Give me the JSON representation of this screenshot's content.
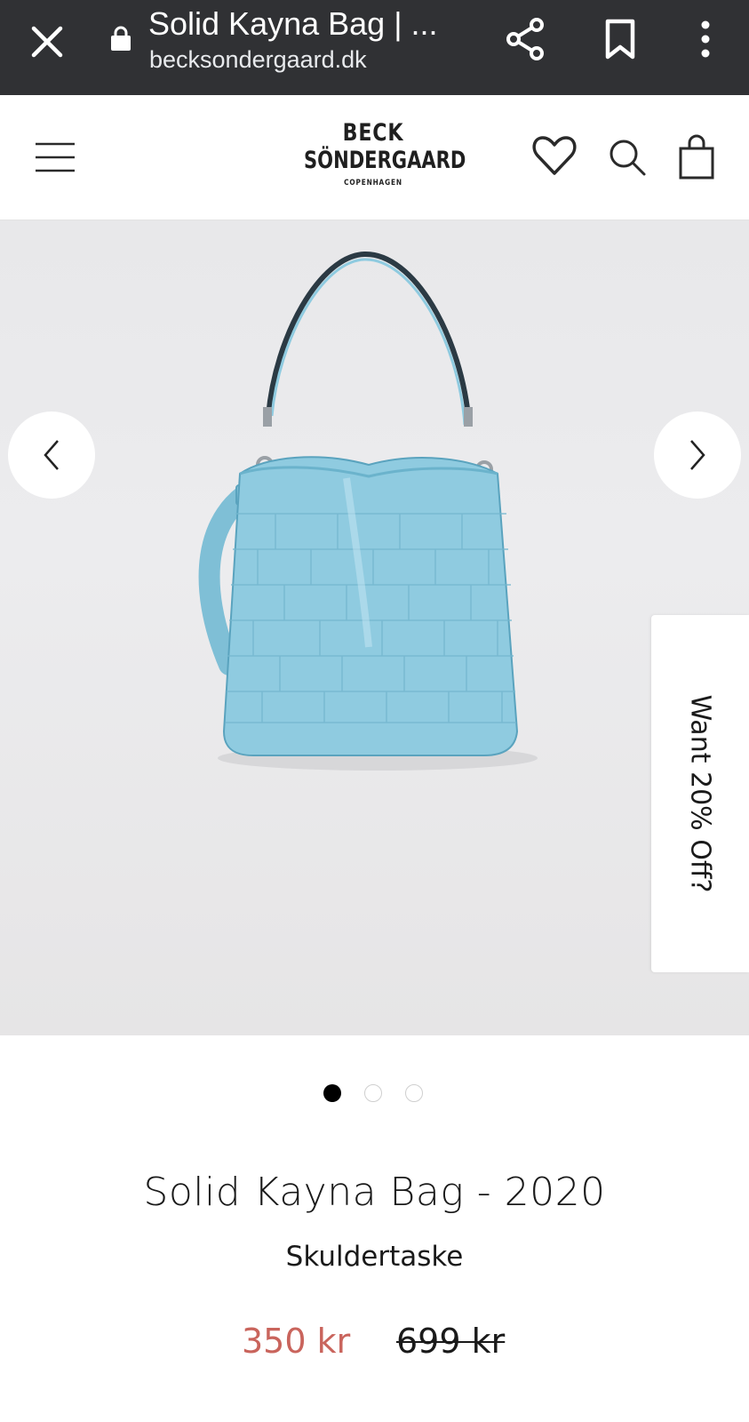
{
  "browser": {
    "tab_title": "Solid Kayna Bag | ...",
    "url": "becksondergaard.dk",
    "icons": [
      "close-icon",
      "lock-icon",
      "share-icon",
      "bookmark-icon",
      "more-vert-icon"
    ]
  },
  "header": {
    "logo": {
      "line1": "BECK",
      "line2": "SÖNDERGAARD",
      "line3": "COPENHAGEN"
    },
    "icons": [
      "hamburger-icon",
      "heart-icon",
      "search-icon",
      "shopping-bag-icon"
    ]
  },
  "gallery": {
    "image_description_icon": "blue-croc-bag-image",
    "promo_label": "Want 20% Off?",
    "dots_total": 3,
    "active_dot": 1
  },
  "product": {
    "title": "Solid Kayna Bag - 2020",
    "subtitle": "Skuldertaske",
    "price_sale": "350 kr",
    "price_original": "699 kr"
  },
  "colors": {
    "browser_bar": "#303134",
    "sale_price": "#c9645c",
    "bag_blue": "#8fcbe0"
  }
}
